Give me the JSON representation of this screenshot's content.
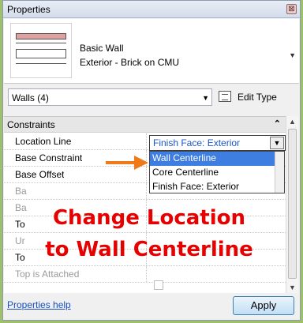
{
  "window": {
    "title": "Properties",
    "close_glyph": "⊠"
  },
  "type_selector": {
    "family": "Basic Wall",
    "type": "Exterior - Brick on CMU",
    "swatch_colors": [
      "#e0a0a0",
      "#555555",
      "#555555",
      "#555555"
    ]
  },
  "filter": {
    "value": "Walls (4)"
  },
  "edit_type": {
    "label": "Edit Type"
  },
  "grid": {
    "group": {
      "label": "Constraints"
    },
    "rows": [
      {
        "name": "Location Line"
      },
      {
        "name": "Base Constraint"
      },
      {
        "name": "Base Offset"
      },
      {
        "name": "Ba"
      },
      {
        "name": "Ba"
      },
      {
        "name": "To"
      },
      {
        "name": "Ur"
      },
      {
        "name": "To"
      },
      {
        "name": "Top is Attached"
      }
    ]
  },
  "location_line": {
    "value": "Finish Face: Exterior",
    "options": [
      "Wall Centerline",
      "Core Centerline",
      "Finish Face: Exterior"
    ],
    "selected_index": 0
  },
  "callout": {
    "line1": "Change Location",
    "line2": "to Wall Centerline",
    "color": "#e60000",
    "arrow_color": "#f07a1a"
  },
  "footer": {
    "help_link": "Properties help",
    "apply_label": "Apply"
  }
}
